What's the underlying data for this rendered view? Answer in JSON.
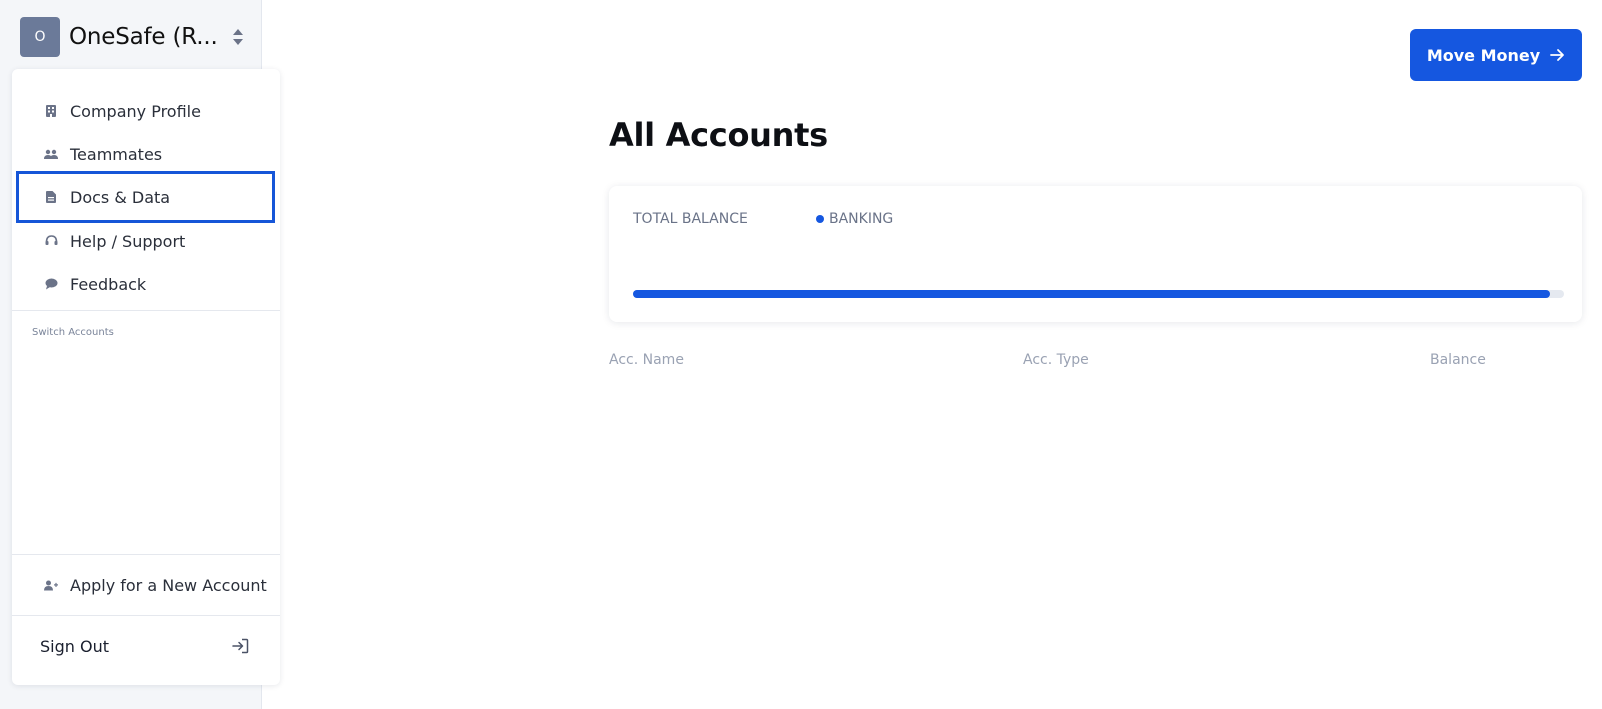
{
  "org": {
    "avatar_letter": "O",
    "name": "OneSafe (R..."
  },
  "menu": {
    "items": [
      {
        "label": "Company Profile",
        "icon": "building-icon"
      },
      {
        "label": "Teammates",
        "icon": "users-icon"
      },
      {
        "label": "Docs & Data",
        "icon": "document-icon",
        "selected": true
      },
      {
        "label": "Help / Support",
        "icon": "headset-icon"
      },
      {
        "label": "Feedback",
        "icon": "chat-bubble-icon"
      }
    ],
    "switch_accounts_label": "Switch Accounts",
    "apply_label": "Apply for a New Account",
    "sign_out_label": "Sign Out"
  },
  "main": {
    "move_money_label": "Move Money",
    "title": "All Accounts",
    "balance_card": {
      "total_balance_label": "TOTAL BALANCE",
      "legend_label": "BANKING",
      "banking_share": 0.985
    },
    "table_headers": [
      "Acc. Name",
      "Acc. Type",
      "Balance"
    ]
  },
  "colors": {
    "accent": "#1557e0",
    "sidebar_bg": "#f4f6f9",
    "avatar_bg": "#6b7a99"
  }
}
